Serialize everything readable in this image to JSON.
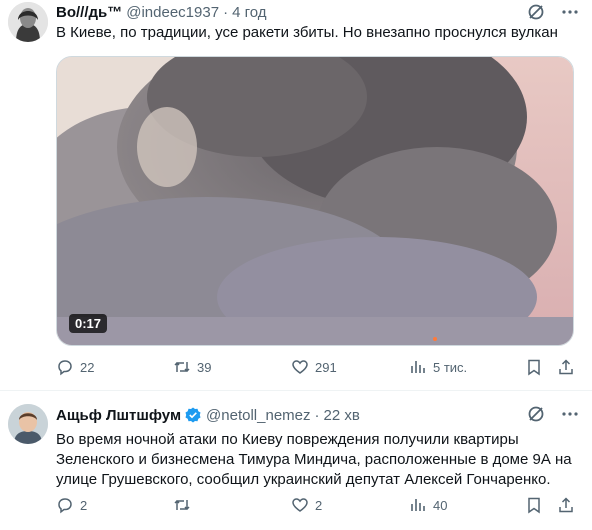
{
  "tweets": [
    {
      "author": {
        "name": "Во///дь™",
        "handle": "@indeec1937"
      },
      "separator": "·",
      "time": "4 год",
      "text": "В Киеве, по традиции, усе ракети збиты. Но внезапно проснулся вулкан",
      "media": {
        "type": "video",
        "duration": "0:17"
      },
      "stats": {
        "replies": "22",
        "reposts": "39",
        "likes": "291",
        "views": "5 тис."
      }
    },
    {
      "author": {
        "name": "Ащьф Лштшфум",
        "handle": "@netoll_nemez",
        "verified": true
      },
      "separator": "·",
      "time": "22 хв",
      "text": "Во время ночной атаки по Киеву повреждения получили квартиры Зеленского и бизнесмена Тимура Миндича, расположенные в доме 9А на улице Грушевского, сообщил украинский депутат Алексей Гончаренко.",
      "stats": {
        "replies": "2",
        "reposts": "",
        "likes": "2",
        "views": "40"
      }
    }
  ],
  "colors": {
    "text": "#0f1419",
    "secondary": "#536471",
    "verified": "#1d9bf0",
    "border": "#eff3f4"
  }
}
